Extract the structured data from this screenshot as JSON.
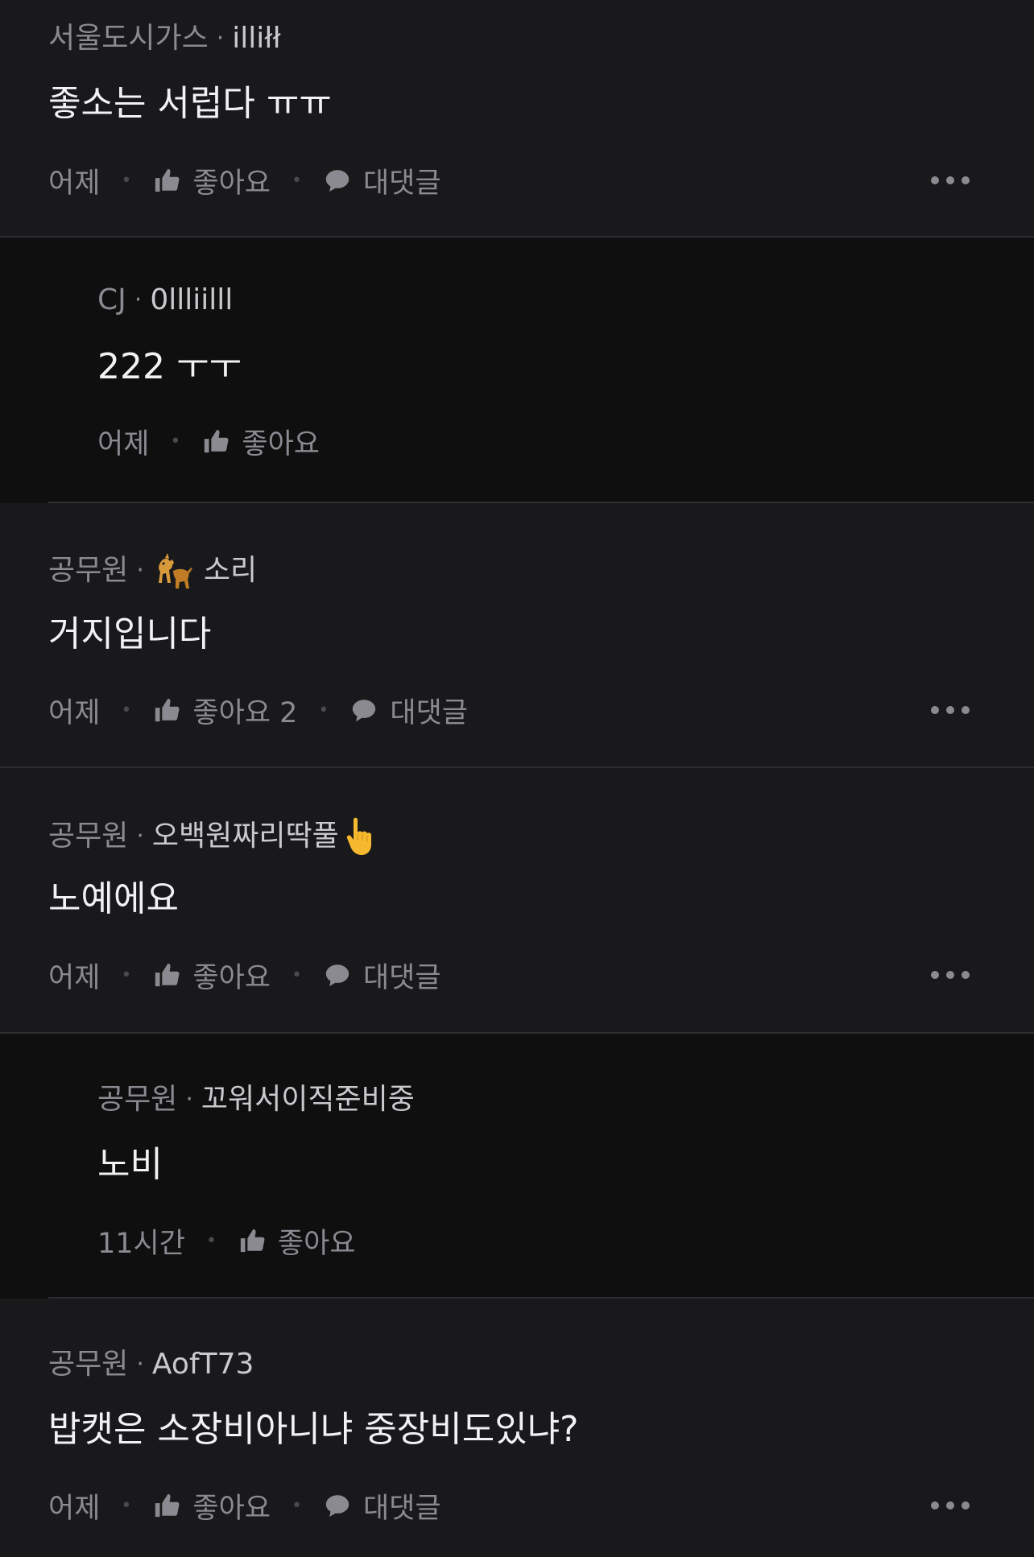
{
  "comments": [
    {
      "company": "서울도시가스",
      "sep": "·",
      "nick": "illiłł",
      "text": "좋소는 서럽다 ㅠㅠ",
      "time": "어제",
      "like_label": "좋아요",
      "reply_label": "대댓글"
    },
    {
      "company": "CJ",
      "sep": "·",
      "nick": "0llliilll",
      "text": "222 ㅜㅜ",
      "time": "어제",
      "like_label": "좋아요"
    },
    {
      "company": "공무원",
      "sep": "·",
      "nick": "소리",
      "nick_icon": "dog-emoji",
      "text": "거지입니다",
      "time": "어제",
      "like_label": "좋아요 2",
      "reply_label": "대댓글"
    },
    {
      "company": "공무원",
      "sep": "·",
      "nick": "오백원짜리딱풀",
      "nick_icon": "pointing-finger-emoji",
      "text": "노예에요",
      "time": "어제",
      "like_label": "좋아요",
      "reply_label": "대댓글"
    },
    {
      "company": "공무원",
      "sep": "·",
      "nick": "꼬워서이직준비중",
      "text": "노비",
      "time": "11시간",
      "like_label": "좋아요"
    },
    {
      "company": "공무원",
      "sep": "·",
      "nick": "AofT73",
      "text": "밥캣은 소장비아니냐 중장비도있냐?",
      "time": "어제",
      "like_label": "좋아요",
      "reply_label": "대댓글"
    }
  ],
  "colors": {
    "background": "#19191b",
    "reply_background": "#0f0f10",
    "text_primary": "#f2f2f4",
    "text_secondary": "#8a8a90",
    "divider": "#2e2e31"
  },
  "icons": {
    "like": "thumbs-up-icon",
    "reply": "speech-bubble-icon",
    "more": "more-dots-icon"
  }
}
